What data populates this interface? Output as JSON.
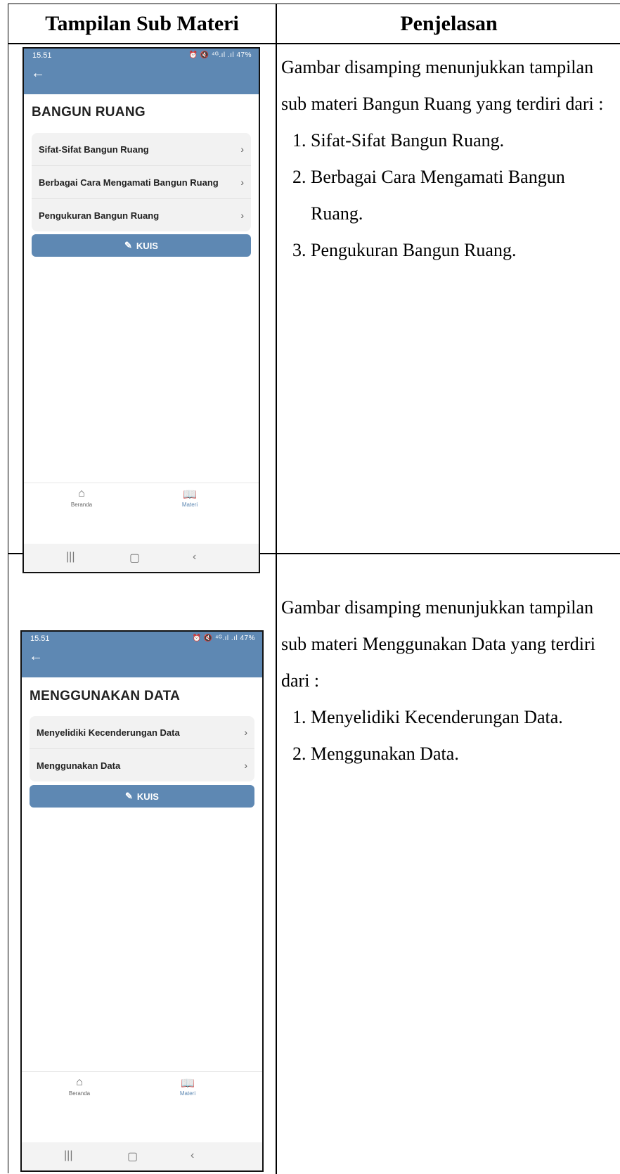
{
  "table": {
    "header_col1": "Tampilan Sub Materi",
    "header_col2": "Penjelasan"
  },
  "screen1": {
    "status_time": "15.51",
    "status_right": "⏰ 🔇 ⁴ᴳ.ıl .ıl 47%",
    "title": "BANGUN RUANG",
    "items": [
      {
        "label": "Sifat-Sifat Bangun Ruang"
      },
      {
        "label": "Berbagai Cara Mengamati Bangun Ruang"
      },
      {
        "label": "Pengukuran Bangun Ruang"
      }
    ],
    "kuis_label": "KUIS",
    "nav_home": "Beranda",
    "nav_materi": "Materi"
  },
  "screen2": {
    "status_time": "15.51",
    "status_right": "⏰ 🔇 ⁴ᴳ.ıl .ıl 47%",
    "title": "MENGGUNAKAN DATA",
    "items": [
      {
        "label": "Menyelidiki Kecenderungan Data"
      },
      {
        "label": "Menggunakan Data"
      }
    ],
    "kuis_label": "KUIS",
    "nav_home": "Beranda",
    "nav_materi": "Materi"
  },
  "desc1": {
    "intro": "Gambar disamping menunjukkan tampilan sub materi Bangun Ruang yang terdiri dari :",
    "items": [
      "Sifat-Sifat Bangun Ruang.",
      "Berbagai Cara Mengamati Bangun Ruang.",
      "Pengukuran Bangun Ruang."
    ]
  },
  "desc2": {
    "intro": "Gambar disamping menunjukkan tampilan sub materi Menggunakan Data yang terdiri dari :",
    "items": [
      "Menyelidiki Kecenderungan Data.",
      "Menggunakan Data."
    ]
  }
}
